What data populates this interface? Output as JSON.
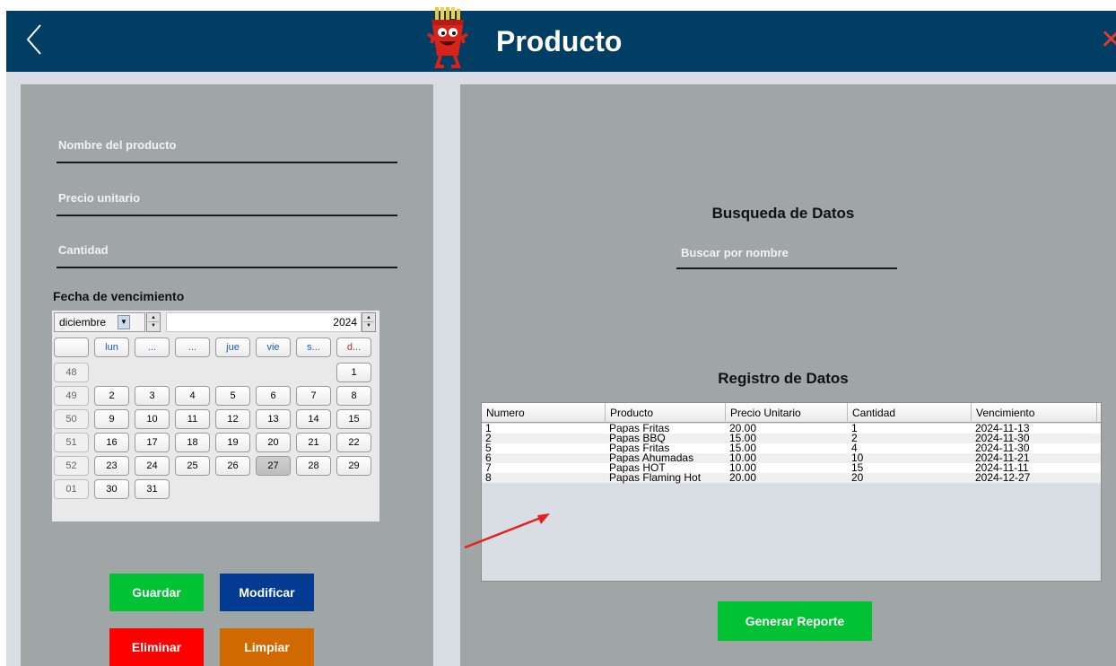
{
  "header": {
    "title": "Producto",
    "back_icon": "chevron-left-icon",
    "close_icon": "close-icon",
    "close_glyph": "✕",
    "logo_icon": "fries-mascot-logo"
  },
  "form": {
    "nombre_placeholder": "Nombre del producto",
    "precio_placeholder": "Precio unitario",
    "cantidad_placeholder": "Cantidad",
    "fecha_label": "Fecha de vencimiento"
  },
  "calendar": {
    "month": "diciembre",
    "year": "2024",
    "day_headers": [
      "",
      "lun",
      "...",
      "...",
      "jue",
      "vie",
      "s...",
      "d..."
    ],
    "weeks": [
      {
        "week": "48",
        "days": [
          "",
          "",
          "",
          "",
          "",
          "",
          "1"
        ]
      },
      {
        "week": "49",
        "days": [
          "2",
          "3",
          "4",
          "5",
          "6",
          "7",
          "8"
        ]
      },
      {
        "week": "50",
        "days": [
          "9",
          "10",
          "11",
          "12",
          "13",
          "14",
          "15"
        ]
      },
      {
        "week": "51",
        "days": [
          "16",
          "17",
          "18",
          "19",
          "20",
          "21",
          "22"
        ]
      },
      {
        "week": "52",
        "days": [
          "23",
          "24",
          "25",
          "26",
          "27",
          "28",
          "29"
        ]
      },
      {
        "week": "01",
        "days": [
          "30",
          "31",
          "",
          "",
          "",
          "",
          ""
        ]
      }
    ],
    "selected_day": "27"
  },
  "buttons": {
    "guardar": "Guardar",
    "modificar": "Modificar",
    "eliminar": "Eliminar",
    "limpiar": "Limpiar",
    "reporte": "Generar Reporte"
  },
  "search": {
    "title": "Busqueda de Datos",
    "placeholder": "Buscar por nombre"
  },
  "registro": {
    "title": "Registro de Datos",
    "columns": [
      "Numero",
      "Producto",
      "Precio Unitario",
      "Cantidad",
      "Vencimiento"
    ],
    "rows": [
      [
        "1",
        "Papas Fritas",
        "20.00",
        "1",
        "2024-11-13"
      ],
      [
        "2",
        "Papas BBQ",
        "15.00",
        "2",
        "2024-11-30"
      ],
      [
        "5",
        "Papas Fritas",
        "15.00",
        "4",
        "2024-11-30"
      ],
      [
        "6",
        "Papas Ahumadas",
        "10.00",
        "10",
        "2024-11-21"
      ],
      [
        "7",
        "Papas HOT",
        "10.00",
        "15",
        "2024-11-11"
      ],
      [
        "8",
        "Papas Flaming Hot",
        "20.00",
        "20",
        "2024-12-27"
      ]
    ]
  },
  "colors": {
    "header_bg": "#003e63",
    "panel_bg": "#a0a5a5",
    "green": "#00c233",
    "blue": "#033b93",
    "red": "#ff0000",
    "orange": "#d06a00",
    "annotation_arrow": "#e8201c"
  }
}
